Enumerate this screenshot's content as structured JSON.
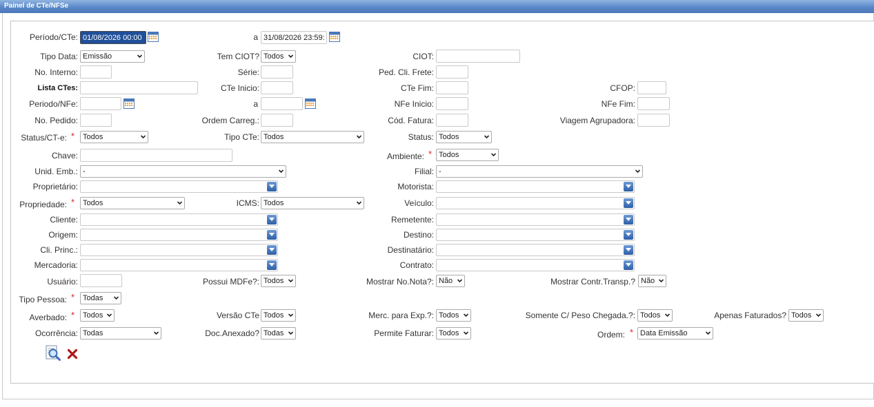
{
  "window": {
    "title": "Painel de CTe/NFSe"
  },
  "labels": {
    "periodo_cte": "Período/CTe:",
    "a1": "a",
    "tipo_data": "Tipo Data:",
    "tem_ciot": "Tem CIOT?",
    "ciot": "CIOT:",
    "no_interno": "No. Interno:",
    "serie": "Série:",
    "ped_cli_frete": "Ped. Cli. Frete:",
    "lista_ctes": "Lista CTes:",
    "cte_inicio": "CTe Inicio:",
    "cte_fim": "CTe Fim:",
    "cfop": "CFOP:",
    "periodo_nfe": "Periodo/NFe:",
    "a2": "a",
    "nfe_inicio": "NFe Inicio:",
    "nfe_fim": "NFe Fim:",
    "no_pedido": "No. Pedido:",
    "ordem_carreg": "Ordem Carreg.:",
    "cod_fatura": "Cód. Fatura:",
    "viagem_agrupadora": "Viagem Agrupadora:",
    "status_cte": "Status/CT-e:",
    "tipo_cte": "Tipo CTe:",
    "status": "Status:",
    "chave": "Chave:",
    "ambiente": "Ambiente:",
    "unid_emb": "Unid. Emb.:",
    "filial": "Filial:",
    "proprietario": "Proprietário:",
    "motorista": "Motorista:",
    "propriedade": "Propriedade:",
    "icms": "ICMS:",
    "veiculo": "Veículo:",
    "cliente": "Cliente:",
    "remetente": "Remetente:",
    "origem": "Origem:",
    "destino": "Destino:",
    "cli_princ": "Cli. Princ.:",
    "destinatario": "Destinatário:",
    "mercadoria": "Mercadoria:",
    "contrato": "Contrato:",
    "usuario": "Usuário:",
    "possui_mdfe": "Possui MDFe?:",
    "mostrar_no_nota": "Mostrar No.Nota?:",
    "mostrar_contr_transp": "Mostrar Contr.Transp.?",
    "tipo_pessoa": "Tipo Pessoa:",
    "averbado": "Averbado:",
    "versao_cte": "Versão CTe",
    "merc_para_exp": "Merc. para Exp.?:",
    "somente_peso_chegada": "Somente C/ Peso Chegada.?:",
    "apenas_faturados": "Apenas Faturados?",
    "ocorrencia": "Ocorrência:",
    "doc_anexado": "Doc.Anexado?",
    "permite_faturar": "Permite Faturar:",
    "ordem": "Ordem:",
    "required_mark": "*"
  },
  "values": {
    "periodo_cte_inicio": "01/08/2026 00:00",
    "periodo_cte_fim": "31/08/2026 23:59:",
    "tipo_data": "Emissão",
    "tem_ciot": "Todos",
    "status_cte": "Todos",
    "tipo_cte": "Todos",
    "status": "Todos",
    "ambiente": "Todos",
    "unid_emb": "-",
    "filial": "-",
    "propriedade": "Todos",
    "icms": "Todos",
    "possui_mdfe": "Todos",
    "mostrar_no_nota": "Não",
    "mostrar_contr_transp": "Não",
    "tipo_pessoa": "Todas",
    "averbado": "Todos",
    "versao_cte": "Todos",
    "merc_para_exp": "Todos",
    "somente_peso_chegada": "Todos",
    "apenas_faturados": "Todos",
    "ocorrencia": "Todas",
    "doc_anexado": "Todas",
    "permite_faturar": "Todos",
    "ordem": "Data Emissão"
  },
  "icons": {
    "calendar": "calendar-icon",
    "search": "search-icon",
    "clear": "close-icon",
    "dropdown": "chevron-down-icon"
  },
  "colors": {
    "title_bar": "#5a88c8",
    "required": "#e02020",
    "selected_field": "#1f4f99",
    "clear_icon": "#b01818"
  }
}
